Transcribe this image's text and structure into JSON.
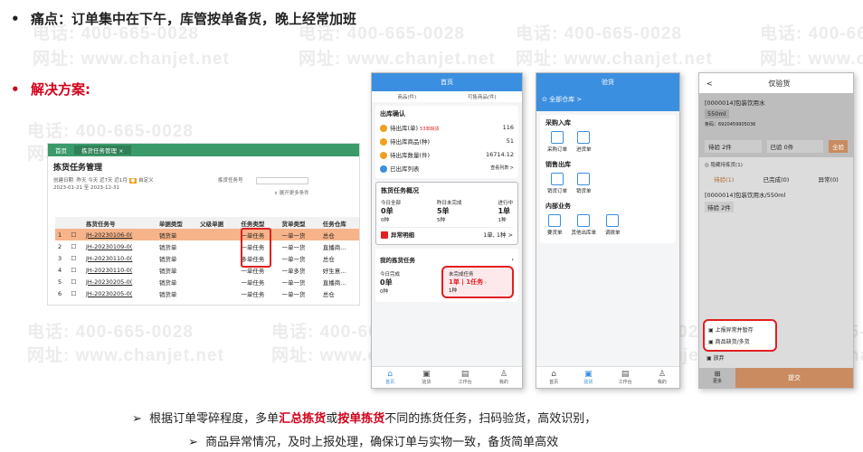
{
  "watermark": {
    "phone": "电话: 400-665-0028",
    "site": "网址: www.chanjet.net"
  },
  "pain_point": "痛点：订单集中在下午，库管按单备货，晚上经常加班",
  "solution_title": "解决方案:",
  "desktop": {
    "tab_home": "首页",
    "tab_active": "拣货任务管理 ×",
    "page_title": "拣货任务管理",
    "filter_created": "创建日期",
    "filter_opts": "昨天  今天  近7天  近1月",
    "filter_range": "2023-01-21 至 2023-12-31",
    "filter_custom": "自定义",
    "filter_task": "拣货任务号",
    "expand_more": "∨ 展开更多条件",
    "columns": [
      "",
      "",
      "拣货任务号",
      "单据类型",
      "父级单据",
      "任务类型",
      "货单类型",
      "任务仓库"
    ],
    "rows": [
      [
        "1",
        "☐",
        "JH-20230106-0(",
        "销货单",
        "",
        "一单任务",
        "一单一货",
        "总仓"
      ],
      [
        "2",
        "☐",
        "JH-20230109-0(",
        "销货单",
        "",
        "一单任务",
        "一单一货",
        "直播商..."
      ],
      [
        "3",
        "☐",
        "JH-20230110-0(",
        "销货单",
        "",
        "多单任务",
        "一单一货",
        "总仓"
      ],
      [
        "4",
        "☐",
        "JH-20230110-0(",
        "销货单",
        "",
        "一单任务",
        "一单多货",
        "好生意..."
      ],
      [
        "5",
        "☐",
        "JH-20230205-0(",
        "销货单",
        "",
        "一单任务",
        "一单一货",
        "直播商..."
      ],
      [
        "6",
        "☐",
        "JH-20230205-0(",
        "销货单",
        "",
        "一单任务",
        "一单一货",
        "总仓"
      ]
    ]
  },
  "phone1": {
    "header": "首页",
    "sub_tabs": [
      "商品(件)",
      "可售商品(件)"
    ],
    "outbound_title": "出库确认",
    "rows": [
      {
        "label": "待出库(单)",
        "badge": "53单缺货",
        "value": "116"
      },
      {
        "label": "待出库商品(种)",
        "value": "51"
      },
      {
        "label": "待出库数量(件)",
        "value": "16714.12"
      }
    ],
    "shipped_label": "已出库列表",
    "shipped_link": "查看列表 >",
    "pick_title": "拣货任务概况",
    "pick_cols": [
      {
        "label": "今日全部",
        "value": "0单",
        "sub": "0种"
      },
      {
        "label": "昨日未完成",
        "value": "5单",
        "sub": "5种"
      },
      {
        "label": "进行中",
        "value": "1单",
        "sub": "1种"
      }
    ],
    "anomaly_label": "异常明细",
    "anomaly_value": "1单, 1种 >",
    "my_tasks": "我的拣货任务",
    "today_done_label": "今日完成",
    "today_done_value": "0单",
    "today_done_sub": "0种",
    "undone_label": "未完成任务",
    "undone_value": "1单 | 1任务",
    "undone_sub": "1种",
    "tabs": [
      {
        "icon": "⌂",
        "label": "首页"
      },
      {
        "icon": "▣",
        "label": "验货"
      },
      {
        "icon": "▤",
        "label": "工作台"
      },
      {
        "icon": "♙",
        "label": "我的"
      }
    ]
  },
  "phone2": {
    "header": "验货",
    "warehouse": "⊙ 全部仓库 >",
    "sec1": "采购入库",
    "sec1_items": [
      "采购订单",
      "进货单"
    ],
    "sec2": "销售出库",
    "sec2_items": [
      "销货订单",
      "销货单"
    ],
    "sec3": "内部业务",
    "sec3_items": [
      "要货单",
      "其他出库单",
      "调拨单"
    ],
    "tabs": [
      {
        "icon": "⌂",
        "label": "首页"
      },
      {
        "icon": "▣",
        "label": "验货"
      },
      {
        "icon": "▤",
        "label": "工作台"
      },
      {
        "icon": "♙",
        "label": "我的"
      }
    ]
  },
  "phone3": {
    "back": "<",
    "header": "仅验货",
    "item_title": "[0000014]包装饮用水",
    "spec": "550ml",
    "barcode": "条码：6920459905036",
    "pending": "待验 2件",
    "checked": "已验 0件",
    "full_btn": "全验",
    "hide_label": "◎ 隐藏待拣货(1)",
    "tabs": [
      "待验(1)",
      "已完成(0)",
      "异常(0)"
    ],
    "item2": "[0000014]包装饮用水/550ml",
    "item2_pending": "待验 2件",
    "menu": [
      "上报异常并暂存",
      "商品缺货/多货",
      "放弃"
    ],
    "more": "更多",
    "submit": "提交"
  },
  "bottom": {
    "line1_pre": "根据订单零碎程度，多单",
    "line1_red1": "汇总拣货",
    "line1_mid": "或",
    "line1_red2": "按单拣货",
    "line1_post": "不同的拣货任务，扫码验货，高效识别，",
    "line2": "商品异常情况，及时上报处理，确保订单与实物一致，备货简单高效"
  },
  "colors": {
    "accent_red": "#d0021b",
    "phone_blue": "#3b8fe0",
    "desk_green": "#3a9a6a",
    "highlight_row": "#f7b48a"
  }
}
